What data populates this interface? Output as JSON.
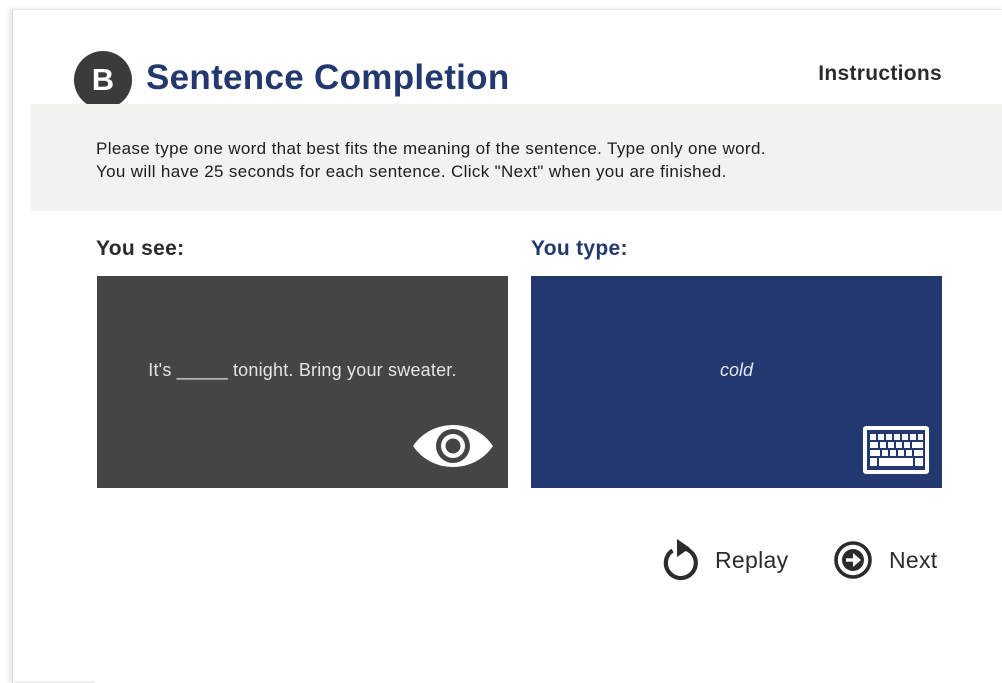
{
  "header": {
    "badge": "B",
    "title": "Sentence Completion",
    "instructions_link": "Instructions"
  },
  "instruction": {
    "lines": [
      "Please type one word that best fits the meaning of the sentence. Type only one word.",
      "You will have 25 seconds for each sentence. Click \"Next\" when you are finished."
    ]
  },
  "see": {
    "label": "You see:",
    "sentence": "It's _____ tonight. Bring your sweater.",
    "icon": "eye-icon"
  },
  "type": {
    "label": "You type:",
    "answer": "cold",
    "icon": "keyboard-icon"
  },
  "actions": {
    "replay_label": "Replay",
    "replay_icon": "replay-icon",
    "next_label": "Next",
    "next_icon": "arrow-right-circle-icon"
  },
  "colors": {
    "navy": "#22386e",
    "dark_gray": "#454545",
    "badge": "#3b3b3b",
    "instruction_bg": "#f2f2f0"
  }
}
